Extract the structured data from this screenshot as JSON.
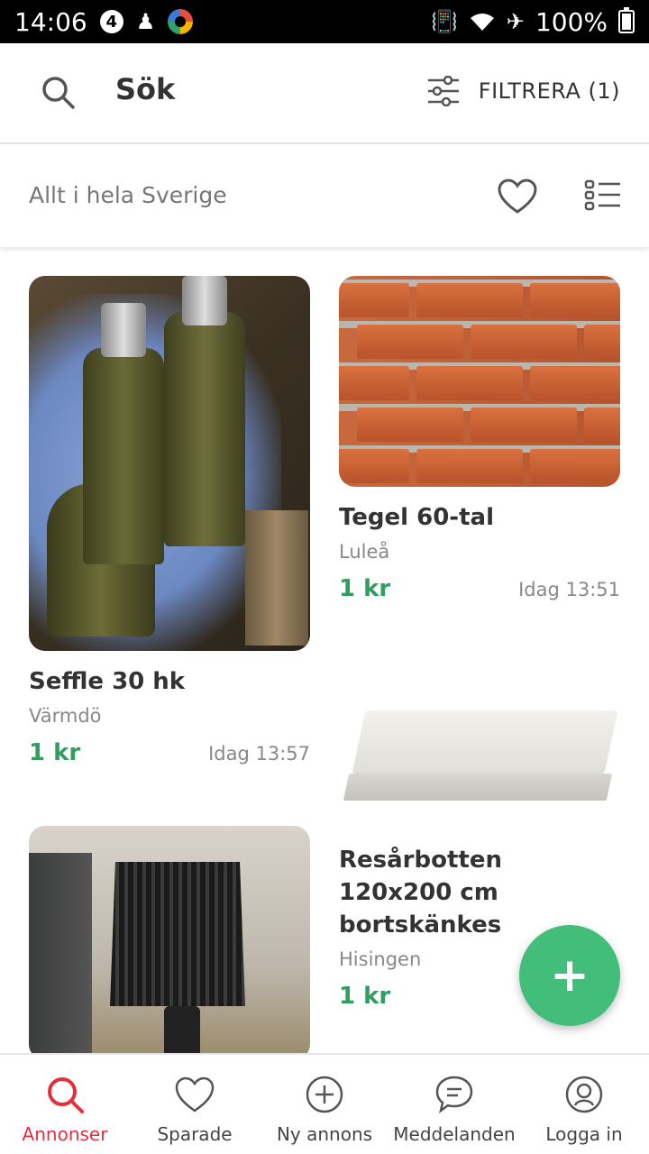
{
  "statusbar": {
    "time": "14:06",
    "badge": "4",
    "battery": "100%"
  },
  "header": {
    "title": "Sök",
    "filter_label": "FILTRERA (1)"
  },
  "location": {
    "text": "Allt i hela Sverige"
  },
  "listings": [
    {
      "name": "Seffle 30 hk",
      "location": "Värmdö",
      "price": "1 kr",
      "time": "Idag 13:57"
    },
    {
      "name": "Tegel 60-tal",
      "location": "Luleå",
      "price": "1 kr",
      "time": "Idag 13:51"
    },
    {
      "name": "Resårbotten 120x200 cm bortskänkes",
      "location": "Hisingen",
      "price": "1 kr",
      "time": ""
    },
    {
      "name": "",
      "location": "",
      "price": "",
      "time": ""
    }
  ],
  "fab": {
    "label": "+"
  },
  "bottom_nav": {
    "items": [
      {
        "label": "Annonser",
        "icon": "search-icon"
      },
      {
        "label": "Sparade",
        "icon": "heart-icon"
      },
      {
        "label": "Ny annons",
        "icon": "plus-circle-icon"
      },
      {
        "label": "Meddelanden",
        "icon": "chat-icon"
      },
      {
        "label": "Logga in",
        "icon": "user-icon"
      }
    ]
  },
  "colors": {
    "accent_green": "#43bd7a",
    "price_green": "#2e9f5e",
    "active_red": "#e0313d"
  }
}
